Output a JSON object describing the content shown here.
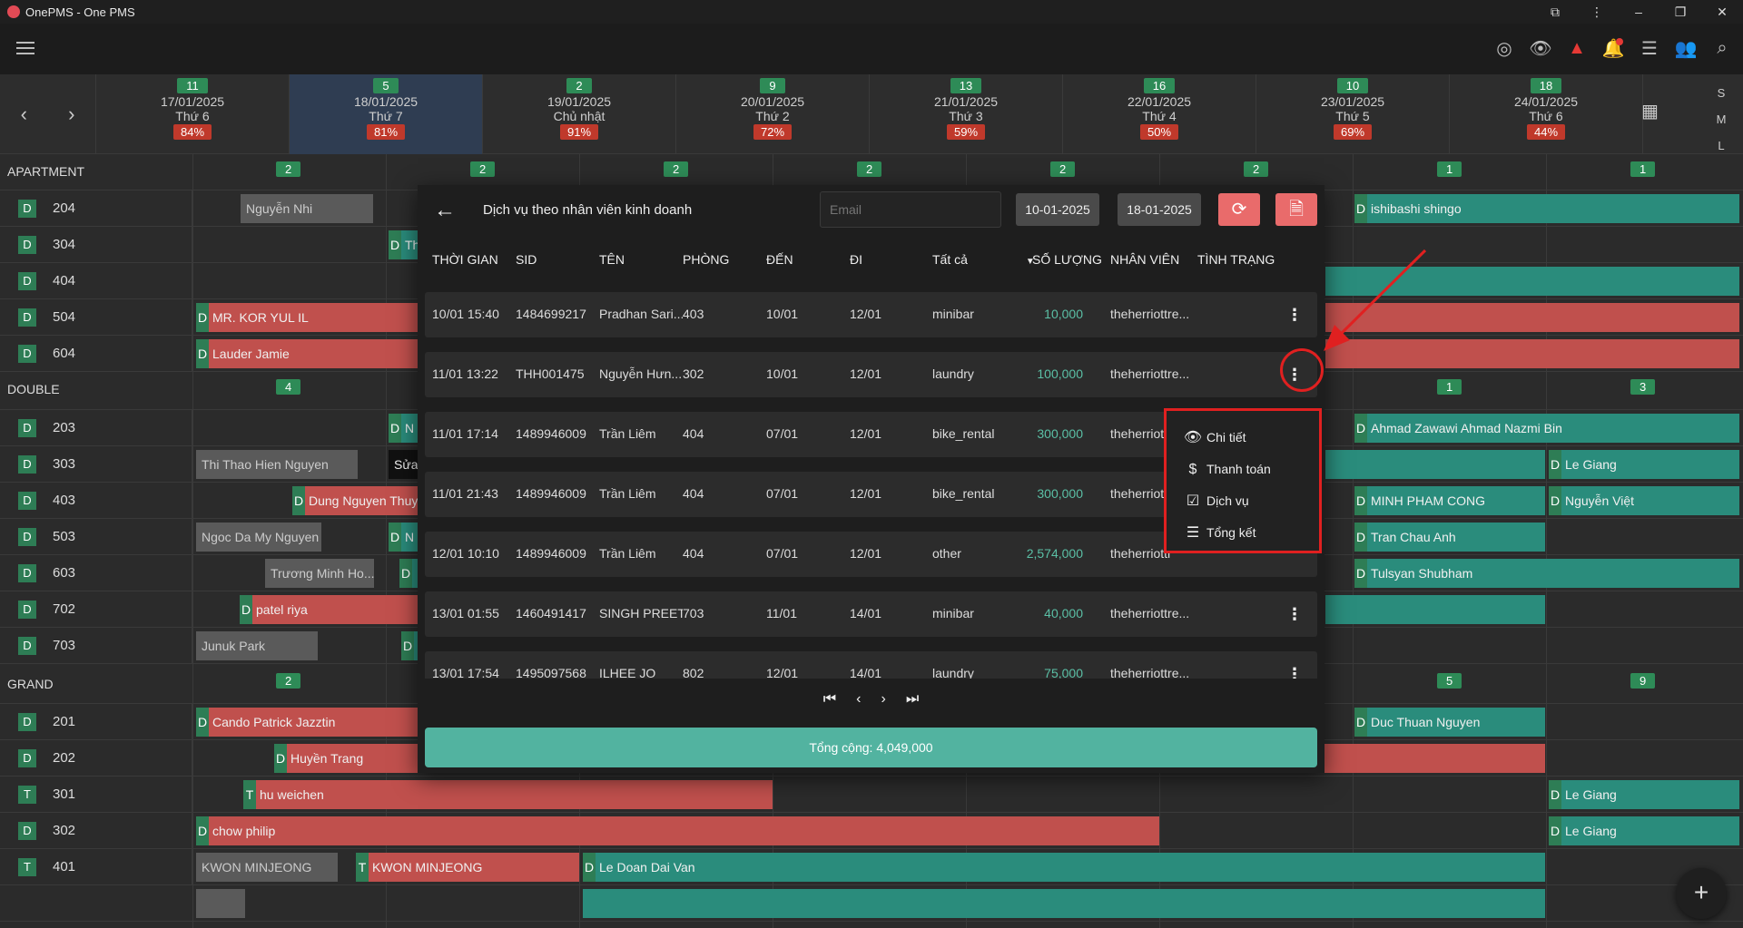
{
  "window": {
    "title": "OnePMS - One PMS"
  },
  "days": [
    {
      "count": "11",
      "date": "17/01/2025",
      "weekday": "Thứ 6",
      "pct": "84%"
    },
    {
      "count": "5",
      "date": "18/01/2025",
      "weekday": "Thứ 7",
      "pct": "81%"
    },
    {
      "count": "2",
      "date": "19/01/2025",
      "weekday": "Chủ nhật",
      "pct": "91%"
    },
    {
      "count": "9",
      "date": "20/01/2025",
      "weekday": "Thứ 2",
      "pct": "72%"
    },
    {
      "count": "13",
      "date": "21/01/2025",
      "weekday": "Thứ 3",
      "pct": "59%"
    },
    {
      "count": "16",
      "date": "22/01/2025",
      "weekday": "Thứ 4",
      "pct": "50%"
    },
    {
      "count": "10",
      "date": "23/01/2025",
      "weekday": "Thứ 5",
      "pct": "69%"
    },
    {
      "count": "18",
      "date": "24/01/2025",
      "weekday": "Thứ 6",
      "pct": "44%"
    }
  ],
  "view_modes": [
    "S",
    "M",
    "L"
  ],
  "groups": {
    "apartment": {
      "name": "APARTMENT",
      "counts": [
        "2",
        "2",
        "2",
        "2",
        "2",
        "2",
        "1",
        "1"
      ]
    },
    "double": {
      "name": "DOUBLE",
      "counts": [
        "4",
        "1",
        "3"
      ]
    },
    "grand": {
      "name": "GRAND",
      "counts": [
        "2",
        "5",
        "9"
      ]
    }
  },
  "rooms": {
    "r204": {
      "type": "D",
      "num": "204"
    },
    "r304": {
      "type": "D",
      "num": "304"
    },
    "r404": {
      "type": "D",
      "num": "404"
    },
    "r504": {
      "type": "D",
      "num": "504"
    },
    "r604": {
      "type": "D",
      "num": "604"
    },
    "r203": {
      "type": "D",
      "num": "203"
    },
    "r303": {
      "type": "D",
      "num": "303"
    },
    "r403": {
      "type": "D",
      "num": "403"
    },
    "r503": {
      "type": "D",
      "num": "503"
    },
    "r603": {
      "type": "D",
      "num": "603"
    },
    "r702": {
      "type": "D",
      "num": "702"
    },
    "r703": {
      "type": "D",
      "num": "703"
    },
    "r201": {
      "type": "D",
      "num": "201"
    },
    "r202": {
      "type": "D",
      "num": "202"
    },
    "r301": {
      "type": "T",
      "num": "301"
    },
    "r302": {
      "type": "D",
      "num": "302"
    },
    "r401": {
      "type": "T",
      "num": "401"
    }
  },
  "bookings": {
    "b204a": "Nguyễn Nhi",
    "b204b": "ishibashi shingo",
    "b504": "MR. KOR YUL IL",
    "b604": "Lauder Jamie",
    "b203": "Ahmad Zawawi Ahmad Nazmi Bin",
    "b303a": "Thi Thao Hien Nguyen",
    "b303b": "Sửa",
    "b303c": "Le Giang",
    "b403a": "Dung Nguyen Thuy",
    "b403b": "MINH PHAM CONG",
    "b403c": "Nguyễn Việt",
    "b503a": "Ngoc Da My Nguyen",
    "b503b": "Tran Chau Anh",
    "b603a": "Trương Minh Ho...",
    "b603b": "Tulsyan Shubham",
    "b702": "patel riya",
    "b703": "Junuk Park",
    "b201a": "Cando Patrick Jazztin",
    "b201b": "Duc Thuan Nguyen",
    "b202": "Huyền Trang",
    "b301a": "hu weichen",
    "b301b": "Le Giang",
    "b302a": "chow philip",
    "b302b": "Le Giang",
    "b401a": "KWON MINJEONG",
    "b401b": "KWON MINJEONG",
    "b401c": "Le Doan Dai Van",
    "partial_n": "N",
    "partial_t": "Th"
  },
  "modal": {
    "title": "Dịch vụ theo nhân viên kinh doanh",
    "email_placeholder": "Email",
    "date_from": "10-01-2025",
    "date_to": "18-01-2025",
    "columns": {
      "time": "THỜI GIAN",
      "sid": "SID",
      "name": "TÊN",
      "room": "PHÒNG",
      "arrive": "ĐẾN",
      "depart": "ĐI",
      "service": "Tất cả",
      "qty": "SỐ LƯỢNG",
      "staff": "NHÂN VIÊN",
      "status": "TÌNH TRẠNG"
    },
    "rows": [
      {
        "time": "10/01 15:40",
        "sid": "1484699217",
        "name": "Pradhan Sari...",
        "room": "403",
        "arrive": "10/01",
        "depart": "12/01",
        "service": "minibar",
        "qty": "10,000",
        "staff": "theherriottre..."
      },
      {
        "time": "11/01 13:22",
        "sid": "THH001475",
        "name": "Nguyễn Hưn...",
        "room": "302",
        "arrive": "10/01",
        "depart": "12/01",
        "service": "laundry",
        "qty": "100,000",
        "staff": "theherriottre..."
      },
      {
        "time": "11/01 17:14",
        "sid": "1489946009",
        "name": "Trần Liêm",
        "room": "404",
        "arrive": "07/01",
        "depart": "12/01",
        "service": "bike_rental",
        "qty": "300,000",
        "staff": "theherriott"
      },
      {
        "time": "11/01 21:43",
        "sid": "1489946009",
        "name": "Trần Liêm",
        "room": "404",
        "arrive": "07/01",
        "depart": "12/01",
        "service": "bike_rental",
        "qty": "300,000",
        "staff": "theherriott"
      },
      {
        "time": "12/01 10:10",
        "sid": "1489946009",
        "name": "Trần Liêm",
        "room": "404",
        "arrive": "07/01",
        "depart": "12/01",
        "service": "other",
        "qty": "2,574,000",
        "staff": "theherriottr"
      },
      {
        "time": "13/01 01:55",
        "sid": "1460491417",
        "name": "SINGH PREET",
        "room": "703",
        "arrive": "11/01",
        "depart": "14/01",
        "service": "minibar",
        "qty": "40,000",
        "staff": "theherriottre..."
      },
      {
        "time": "13/01 17:54",
        "sid": "1495097568",
        "name": "ILHEE JO",
        "room": "802",
        "arrive": "12/01",
        "depart": "14/01",
        "service": "laundry",
        "qty": "75,000",
        "staff": "theherriottre..."
      }
    ],
    "total": "Tổng cộng: 4,049,000"
  },
  "context_menu": {
    "items": [
      {
        "label": "Chi tiết",
        "icon": "eye-icon"
      },
      {
        "label": "Thanh toán",
        "icon": "dollar-icon"
      },
      {
        "label": "Dịch vụ",
        "icon": "checklist-icon"
      },
      {
        "label": "Tổng kết",
        "icon": "list-icon"
      }
    ]
  },
  "colors": {
    "accent": "#52b3a0",
    "refresh": "#e96b6b",
    "highlight": "#e02020"
  }
}
